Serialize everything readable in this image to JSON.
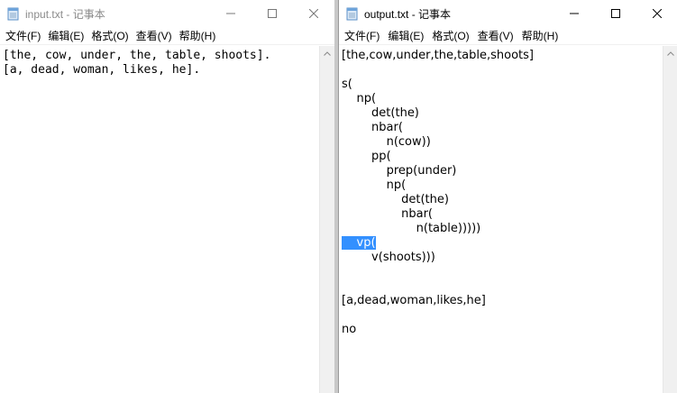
{
  "left_window": {
    "title": "input.txt - 记事本",
    "menu": [
      "文件(F)",
      "编辑(E)",
      "格式(O)",
      "查看(V)",
      "帮助(H)"
    ],
    "lines": [
      "[the, cow, under, the, table, shoots].",
      "[a, dead, woman, likes, he]."
    ]
  },
  "right_window": {
    "title": "output.txt - 记事本",
    "menu": [
      "文件(F)",
      "编辑(E)",
      "格式(O)",
      "查看(V)",
      "帮助(H)"
    ],
    "lines": [
      "[the,cow,under,the,table,shoots]",
      "",
      "s(",
      "    np(",
      "        det(the)",
      "        nbar(",
      "            n(cow))",
      "        pp(",
      "            prep(under)",
      "            np(",
      "                det(the)",
      "                nbar(",
      "                    n(table)))))",
      "    vp(",
      "        v(shoots)))",
      "",
      "",
      "[a,dead,woman,likes,he]",
      "",
      "no"
    ],
    "selected_line_index": 13
  },
  "icons": {
    "app": "notepad-icon",
    "minimize": "minimize-icon",
    "maximize": "maximize-icon",
    "close": "close-icon",
    "scroll_up": "scroll-up-arrow-icon"
  }
}
